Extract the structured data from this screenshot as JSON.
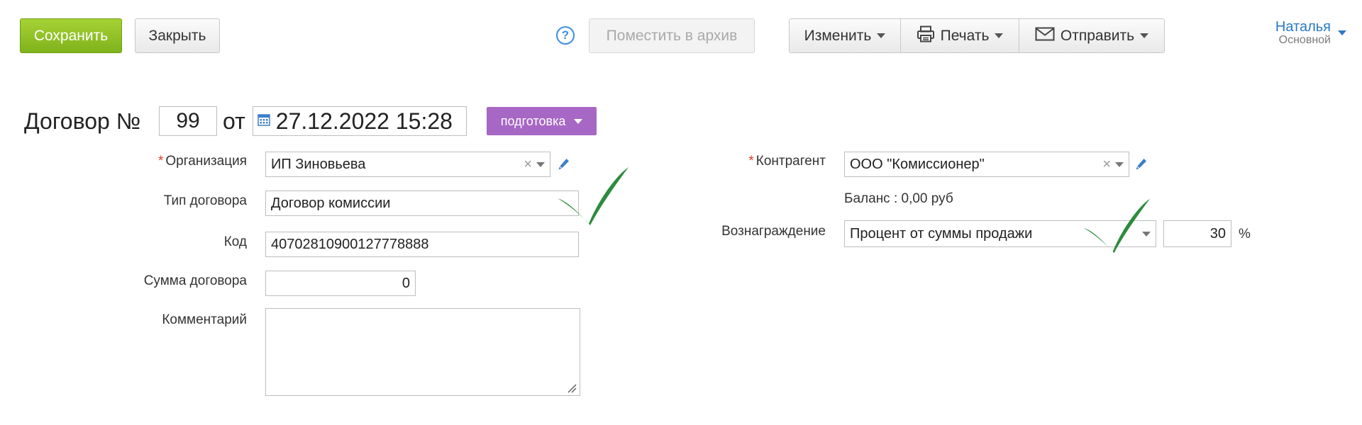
{
  "toolbar": {
    "save_label": "Сохранить",
    "close_label": "Закрыть",
    "help_label": "?",
    "archive_label": "Поместить в архив",
    "edit_label": "Изменить",
    "print_label": "Печать",
    "send_label": "Отправить"
  },
  "user": {
    "name": "Наталья",
    "role": "Основной"
  },
  "header": {
    "title": "Договор №",
    "number": "99",
    "from_label": "от",
    "datetime": "27.12.2022 15:28",
    "status": "подготовка"
  },
  "form": {
    "organization": {
      "label": "Организация",
      "value": "ИП Зиновьева"
    },
    "contract_type": {
      "label": "Тип договора",
      "value": "Договор комиссии"
    },
    "code": {
      "label": "Код",
      "value": "40702810900127778888"
    },
    "amount": {
      "label": "Сумма договора",
      "value": "0"
    },
    "comment": {
      "label": "Комментарий",
      "value": ""
    },
    "counterparty": {
      "label": "Контрагент",
      "value": "ООО \"Комиссионер\""
    },
    "balance": "Баланс : 0,00 руб",
    "reward": {
      "label": "Вознаграждение",
      "value": "Процент от суммы продажи",
      "percent": "30",
      "percent_sign": "%"
    },
    "required_mark": "*",
    "clear_symbol": "×"
  },
  "colors": {
    "save_green": "#8cc026",
    "status_purple": "#a767c4",
    "link_blue": "#2a78c4",
    "checkmark_green": "#2e8b3e",
    "required_red": "#d83a2e"
  },
  "icons": [
    "help-icon",
    "printer-icon",
    "envelope-icon",
    "calendar-icon",
    "pencil-icon",
    "clear-icon",
    "chevron-down-icon",
    "checkmark-icon"
  ]
}
